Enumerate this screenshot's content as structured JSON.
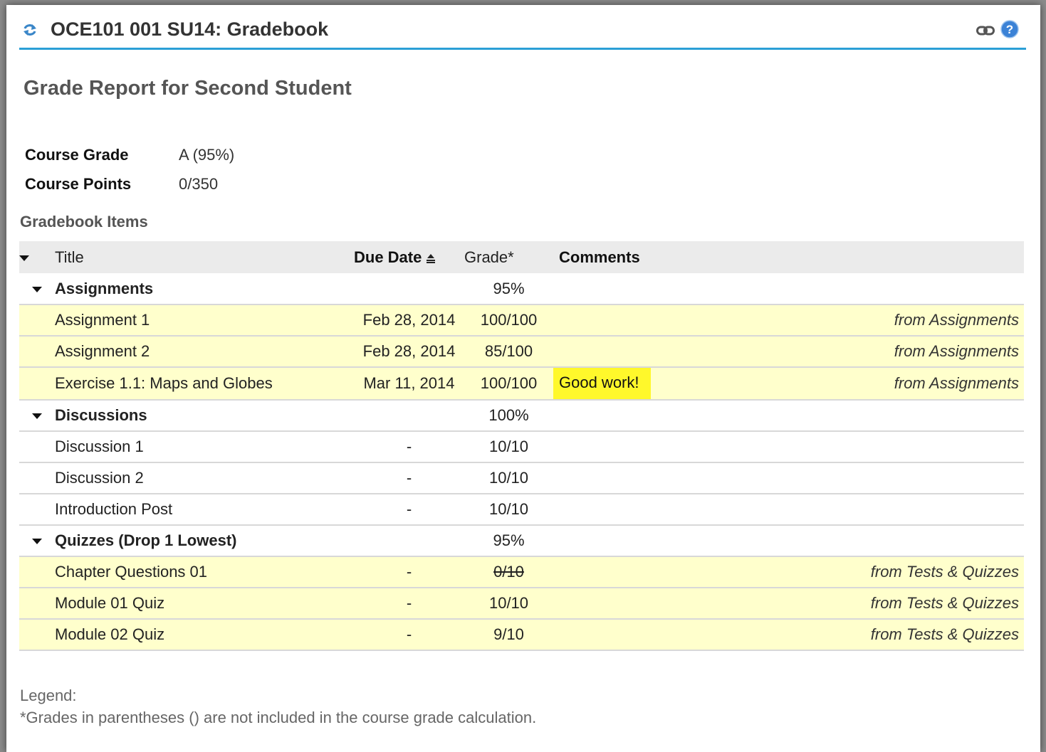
{
  "window": {
    "title": "OCE101 001 SU14: Gradebook"
  },
  "report": {
    "title": "Grade Report for Second Student",
    "course_grade_label": "Course Grade",
    "course_grade_value": "A (95%)",
    "course_points_label": "Course Points",
    "course_points_value": "0/350"
  },
  "gradebook": {
    "heading": "Gradebook Items",
    "columns": {
      "title": "Title",
      "due_date": "Due Date",
      "grade": "Grade*",
      "comments": "Comments"
    },
    "categories": [
      {
        "name": "Assignments",
        "grade": "95%",
        "items": [
          {
            "title": "Assignment 1",
            "due": "Feb 28, 2014",
            "grade": "100/100",
            "comment": "",
            "source": "from Assignments"
          },
          {
            "title": "Assignment 2",
            "due": "Feb 28, 2014",
            "grade": "85/100",
            "comment": "",
            "source": "from Assignments"
          },
          {
            "title": "Exercise 1.1: Maps and Globes",
            "due": "Mar 11, 2014",
            "grade": "100/100",
            "comment": "Good work!",
            "source": "from Assignments"
          }
        ]
      },
      {
        "name": "Discussions",
        "grade": "100%",
        "items": [
          {
            "title": "Discussion 1",
            "due": "-",
            "grade": "10/10",
            "comment": "",
            "source": ""
          },
          {
            "title": "Discussion 2",
            "due": "-",
            "grade": "10/10",
            "comment": "",
            "source": ""
          },
          {
            "title": "Introduction Post",
            "due": "-",
            "grade": "10/10",
            "comment": "",
            "source": ""
          }
        ]
      },
      {
        "name": "Quizzes (Drop 1 Lowest)",
        "grade": "95%",
        "items": [
          {
            "title": "Chapter Questions 01",
            "due": "-",
            "grade": "0/10",
            "dropped": true,
            "comment": "",
            "source": "from Tests & Quizzes"
          },
          {
            "title": "Module 01 Quiz",
            "due": "-",
            "grade": "10/10",
            "comment": "",
            "source": "from Tests & Quizzes"
          },
          {
            "title": "Module 02 Quiz",
            "due": "-",
            "grade": "9/10",
            "comment": "",
            "source": "from Tests & Quizzes"
          }
        ]
      }
    ]
  },
  "legend": {
    "label": "Legend:",
    "note": "*Grades in parentheses () are not included in the course grade calculation."
  },
  "colors": {
    "accent": "#2b9fd6",
    "row_highlight": "#ffffcc",
    "comment_highlight": "#fff82b",
    "header_bg": "#ebebeb"
  },
  "icons": {
    "refresh": "refresh-icon",
    "link": "link-icon",
    "help": "help-icon",
    "sort": "sort-ascending-icon",
    "collapse": "caret-down-icon"
  }
}
